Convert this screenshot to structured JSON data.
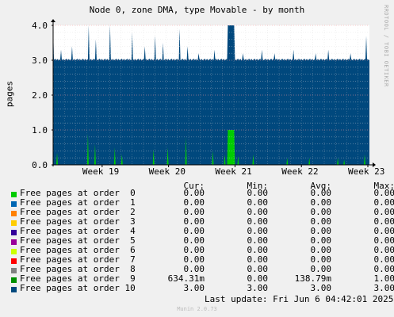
{
  "title": "Node 0, zone DMA, type Movable - by month",
  "watermark": "RRDTOOL / TOBI OETIKER",
  "ylabel": "pages",
  "columns": [
    "Cur:",
    "Min:",
    "Avg:",
    "Max:"
  ],
  "legend": [
    {
      "name": "Free pages at order  0",
      "color": "#00cc00",
      "cur": "0.00",
      "min": "0.00",
      "avg": "0.00",
      "max": "0.00"
    },
    {
      "name": "Free pages at order  1",
      "color": "#0066b3",
      "cur": "0.00",
      "min": "0.00",
      "avg": "0.00",
      "max": "0.00"
    },
    {
      "name": "Free pages at order  2",
      "color": "#ff8000",
      "cur": "0.00",
      "min": "0.00",
      "avg": "0.00",
      "max": "0.00"
    },
    {
      "name": "Free pages at order  3",
      "color": "#ffcc00",
      "cur": "0.00",
      "min": "0.00",
      "avg": "0.00",
      "max": "0.00"
    },
    {
      "name": "Free pages at order  4",
      "color": "#330099",
      "cur": "0.00",
      "min": "0.00",
      "avg": "0.00",
      "max": "0.00"
    },
    {
      "name": "Free pages at order  5",
      "color": "#990099",
      "cur": "0.00",
      "min": "0.00",
      "avg": "0.00",
      "max": "0.00"
    },
    {
      "name": "Free pages at order  6",
      "color": "#ccff00",
      "cur": "0.00",
      "min": "0.00",
      "avg": "0.00",
      "max": "0.00"
    },
    {
      "name": "Free pages at order  7",
      "color": "#ff0000",
      "cur": "0.00",
      "min": "0.00",
      "avg": "0.00",
      "max": "0.00"
    },
    {
      "name": "Free pages at order  8",
      "color": "#808080",
      "cur": "0.00",
      "min": "0.00",
      "avg": "0.00",
      "max": "0.00"
    },
    {
      "name": "Free pages at order  9",
      "color": "#008f00",
      "cur": "634.31m",
      "min": "0.00",
      "avg": "138.79m",
      "max": "1.00"
    },
    {
      "name": "Free pages at order 10",
      "color": "#00487d",
      "cur": "3.00",
      "min": "3.00",
      "avg": "3.00",
      "max": "3.00"
    }
  ],
  "footer": "Last update: Fri Jun  6 04:42:01 2025",
  "munin": "Munin 2.0.73",
  "chart_data": {
    "type": "area",
    "title": "Node 0, zone DMA, type Movable - by month",
    "ylabel": "pages",
    "xlabel": "",
    "ylim": [
      0,
      4
    ],
    "yticks": [
      "0.0",
      "1.0",
      "2.0",
      "3.0",
      "4.0"
    ],
    "yvalues": [
      0,
      1,
      2,
      3,
      4
    ],
    "x_ticks": [
      "Week 19",
      "Week 20",
      "Week 21",
      "Week 22",
      "Week 23"
    ],
    "grid": true,
    "series": [
      {
        "name": "Free pages at order  9",
        "baseline": 0,
        "spikes_at": [
          0.012,
          0.11,
          0.133,
          0.195,
          0.218,
          0.318,
          0.362,
          0.42,
          0.505,
          0.542,
          0.585,
          0.632,
          0.74,
          0.81,
          0.9,
          0.92,
          0.985
        ],
        "spike_values": [
          0.35,
          0.9,
          0.6,
          0.5,
          0.3,
          0.45,
          0.5,
          0.8,
          0.4,
          0.3,
          0.25,
          0.3,
          0.2,
          0.2,
          0.2,
          0.15,
          0.3
        ],
        "plateau": {
          "from": 0.552,
          "to": 0.572,
          "value": 1.0
        }
      },
      {
        "name": "Free pages at order 10",
        "baseline": 3.0,
        "spikes_at": [
          0.0,
          0.025,
          0.06,
          0.112,
          0.135,
          0.18,
          0.25,
          0.29,
          0.322,
          0.348,
          0.4,
          0.425,
          0.46,
          0.51,
          0.6,
          0.66,
          0.7,
          0.76,
          0.83,
          0.87,
          0.94,
          0.99
        ],
        "spike_values": [
          4.0,
          3.3,
          3.4,
          4.0,
          3.6,
          4.0,
          3.8,
          3.4,
          3.7,
          3.5,
          3.9,
          3.4,
          3.2,
          3.3,
          3.2,
          3.3,
          3.2,
          3.3,
          3.2,
          3.3,
          3.2,
          3.7
        ],
        "plateau": {
          "from": 0.552,
          "to": 0.572,
          "value": 4.0
        }
      }
    ]
  }
}
